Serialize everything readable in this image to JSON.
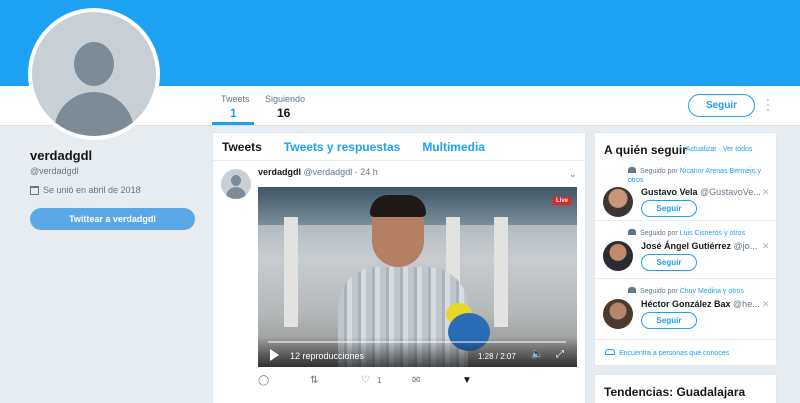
{
  "nav": {
    "stats": [
      {
        "label": "Tweets",
        "value": "1"
      },
      {
        "label": "Siguiendo",
        "value": "16"
      }
    ],
    "follow_label": "Seguir"
  },
  "profile": {
    "name": "verdadgdl",
    "handle": "@verdadgdl",
    "joined": "Se unió en abril de 2018",
    "tweet_to_label": "Twittear a verdadgdl"
  },
  "timeline": {
    "tabs": [
      "Tweets",
      "Tweets y respuestas",
      "Multimedia"
    ],
    "tweet": {
      "name": "verdadgdl",
      "handle": "@verdadgdl",
      "time": "· 24 h",
      "video": {
        "views": "12 reproducciones",
        "time": "1:28 / 2:07",
        "live_badge": "Live"
      },
      "likes": "1"
    }
  },
  "who_to_follow": {
    "title": "A quién seguir",
    "links": "· Actualizar · Ver todos",
    "suggestions": [
      {
        "context_prefix": "Seguido por",
        "context_names": "Nicanor Arenas Bermejo y otros",
        "name": "Gustavo Vela",
        "handle": "@GustavoVe...",
        "button": "Seguir"
      },
      {
        "context_prefix": "Seguido por",
        "context_names": "Luis Cisneros y otros",
        "name": "José Ángel Gutiérrez",
        "handle": "@jo...",
        "button": "Seguir"
      },
      {
        "context_prefix": "Seguido por",
        "context_names": "Chuy Medina y otros",
        "name": "Héctor González Bax",
        "handle": "@he...",
        "button": "Seguir"
      }
    ],
    "find_people": "Encuentra a personas que conoces"
  },
  "trends": {
    "title": "Tendencias: Guadalajara"
  },
  "colors": {
    "brand": "#1da1f2",
    "banner": "#1da1f2",
    "background": "#e6ecf0"
  }
}
